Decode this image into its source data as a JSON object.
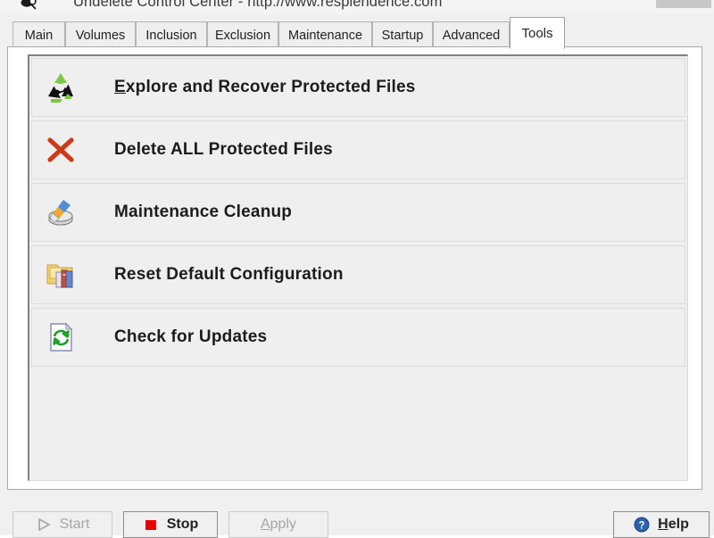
{
  "window": {
    "title": "Undelete Control Center - http://www.resplendence.com",
    "icon": "app-icon"
  },
  "tabs": [
    {
      "label": "Main",
      "active": false
    },
    {
      "label": "Volumes",
      "active": false
    },
    {
      "label": "Inclusion",
      "active": false
    },
    {
      "label": "Exclusion",
      "active": false
    },
    {
      "label": "Maintenance",
      "active": false
    },
    {
      "label": "Startup",
      "active": false
    },
    {
      "label": "Advanced",
      "active": false
    },
    {
      "label": "Tools",
      "active": true
    }
  ],
  "tools": [
    {
      "label_prefix": "",
      "label_accel": "E",
      "label_suffix": "xplore and Recover Protected Files",
      "icon": "recycle-icon"
    },
    {
      "label_prefix": "Delete ALL Protected Files",
      "label_accel": "",
      "label_suffix": "",
      "icon": "red-x-icon"
    },
    {
      "label_prefix": "Maintenance Cleanup",
      "label_accel": "",
      "label_suffix": "",
      "icon": "disk-broom-icon"
    },
    {
      "label_prefix": "Reset Default Configuration",
      "label_accel": "",
      "label_suffix": "",
      "icon": "folder-books-icon"
    },
    {
      "label_prefix": "Check for Updates",
      "label_accel": "",
      "label_suffix": "",
      "icon": "page-refresh-icon"
    }
  ],
  "buttons": {
    "start": {
      "label": "Start",
      "enabled": false,
      "icon": "play-triangle-icon"
    },
    "stop": {
      "label": "Stop",
      "enabled": true,
      "icon": "stop-square-icon"
    },
    "apply": {
      "label_accel": "A",
      "label_suffix": "pply",
      "enabled": false
    },
    "help": {
      "label_accel": "H",
      "label_suffix": "elp",
      "enabled": true,
      "icon": "question-circle-icon"
    }
  },
  "colors": {
    "accent_green": "#56b52a",
    "accent_red": "#cc3a18",
    "stop_red": "#ee0000",
    "help_blue": "#2a63b0",
    "window_bg": "#f0f0f0",
    "panel_bg": "#ffffff",
    "list_bg": "#efefef"
  }
}
